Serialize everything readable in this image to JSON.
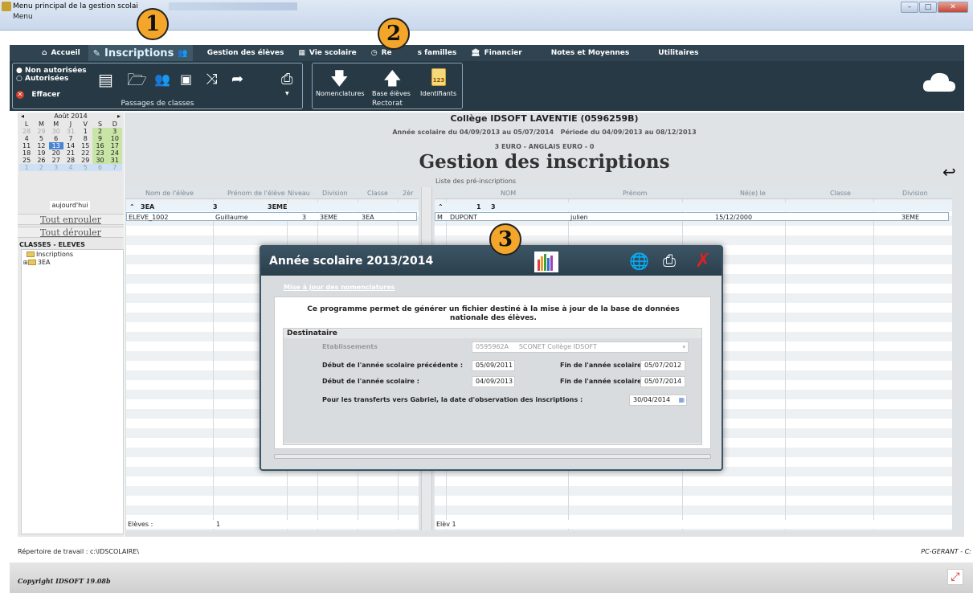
{
  "window": {
    "title": "Menu principal de la gestion scolai",
    "menu": "Menu"
  },
  "nav": {
    "accueil": "Accueil",
    "inscriptions": "Inscriptions",
    "gestion_eleves": "Gestion des élèves",
    "vie_scolaire": "Vie scolaire",
    "relations": "Re",
    "familles": "s familles",
    "financier": "Financier",
    "notes": "Notes et Moyennes",
    "utilitaires": "Utilitaires"
  },
  "ribbon": {
    "non_autorisees": "Non autorisées",
    "autorisees": "Autorisées",
    "effacer": "Effacer",
    "passages_classes": "Passages de classes",
    "nomenclatures": "Nomenclatures",
    "base_eleves": "Base élèves",
    "identifiants": "Identifiants",
    "identifiants_badge": "123",
    "rectorat": "Rectorat"
  },
  "calendar": {
    "month": "Août 2014",
    "weekdays": [
      "L",
      "M",
      "M",
      "J",
      "V",
      "S",
      "D"
    ],
    "rows": [
      [
        "28",
        "29",
        "30",
        "31",
        "1",
        "2",
        "3"
      ],
      [
        "4",
        "5",
        "6",
        "7",
        "8",
        "9",
        "10"
      ],
      [
        "11",
        "12",
        "13",
        "14",
        "15",
        "16",
        "17"
      ],
      [
        "18",
        "19",
        "20",
        "21",
        "22",
        "23",
        "24"
      ],
      [
        "25",
        "26",
        "27",
        "28",
        "29",
        "30",
        "31"
      ],
      [
        "1",
        "2",
        "3",
        "4",
        "5",
        "6",
        "7"
      ]
    ],
    "today_label": "aujourd'hui",
    "tout_enrouler": "Tout enrouler",
    "tout_derouler": "Tout dérouler"
  },
  "tree": {
    "title": "CLASSES - ELEVES",
    "items": [
      "Inscriptions",
      "3EA"
    ]
  },
  "header": {
    "college": "Collège IDSOFT LAVENTIE (0596259B)",
    "annee": "Année scolaire du 04/09/2013 au 05/07/2014",
    "periode": "Période du 04/09/2013 au 08/12/2013",
    "langues": "3 EURO - ANGLAIS EURO - 0",
    "page_title": "Gestion des inscriptions"
  },
  "left_grid": {
    "columns": [
      "Nom de l'élève",
      "Prénom de l'élève",
      "Niveau",
      "Division",
      "Classe",
      "2èr"
    ],
    "group": {
      "name": "3EA",
      "count": "3",
      "division": "3EME"
    },
    "rows": [
      {
        "nom": "ELEVE_1002",
        "prenom": "Guillaume",
        "niveau": "3",
        "division": "3EME",
        "classe": "3EA"
      }
    ],
    "footer_label": "Elèves :",
    "footer_count": "1"
  },
  "right_grid": {
    "caption": "Liste des pré-inscriptions",
    "columns": [
      "NOM",
      "Prénom",
      "Né(e) le",
      "Classe",
      "Division"
    ],
    "group": {
      "count": "1",
      "count2": "3"
    },
    "rows": [
      {
        "sexe": "M",
        "nom": "DUPONT",
        "prenom": "julien",
        "ne_le": "15/12/2000",
        "classe": "",
        "division": "3EME"
      }
    ],
    "footer_label": "Elèv 1"
  },
  "dialog": {
    "title": "Année scolaire 2013/2014",
    "link": "Mise à jour des nomenclatures",
    "description": "Ce programme permet de générer un fichier destiné à la mise à jour de la base de données nationale des élèves.",
    "section": "Destinataire",
    "etab_label": "Etablissements",
    "etab_code": "0595962A",
    "etab_value": "SCONET Collège IDSOFT",
    "debut_prec_label": "Début de l'année scolaire précédente :",
    "debut_prec": "05/09/2011",
    "fin_prec_label": "Fin de l'année scolaire :",
    "fin_prec": "05/07/2012",
    "debut_label": "Début de l'année scolaire :",
    "debut": "04/09/2013",
    "fin_label": "Fin de l'année scolaire :",
    "fin": "05/07/2014",
    "transfert_label": "Pour les transferts vers Gabriel, la date d'observation des inscriptions :",
    "transfert": "30/04/2014"
  },
  "badges": [
    "1",
    "2",
    "3"
  ],
  "status": {
    "left": "Répertoire de travail : c:\\IDSCOLAIRE\\",
    "right": "PC-GERANT - C:"
  },
  "footer": {
    "copyright": "Copyright IDSOFT 19.08b"
  }
}
